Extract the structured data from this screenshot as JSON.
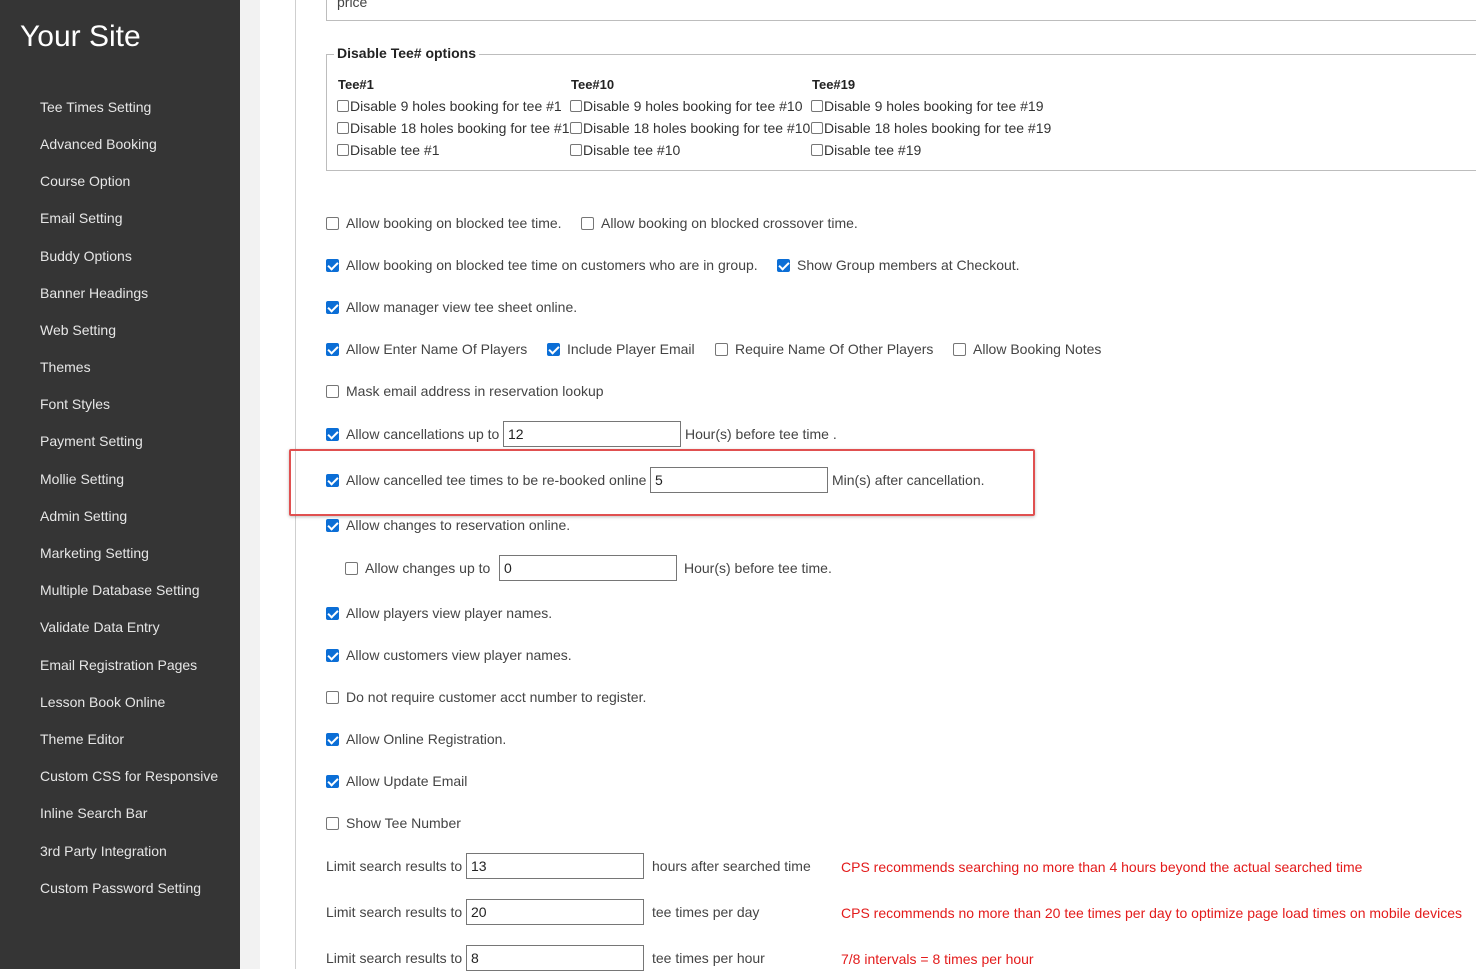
{
  "sidebar": {
    "title": "Your Site",
    "items": [
      {
        "label": "Tee Times Setting"
      },
      {
        "label": "Advanced Booking"
      },
      {
        "label": "Course Option"
      },
      {
        "label": "Email Setting"
      },
      {
        "label": "Buddy Options"
      },
      {
        "label": "Banner Headings"
      },
      {
        "label": "Web Setting"
      },
      {
        "label": "Themes"
      },
      {
        "label": "Font Styles"
      },
      {
        "label": "Payment Setting"
      },
      {
        "label": "Mollie Setting"
      },
      {
        "label": "Admin Setting"
      },
      {
        "label": "Marketing Setting"
      },
      {
        "label": "Multiple Database Setting"
      },
      {
        "label": "Validate Data Entry"
      },
      {
        "label": "Email Registration Pages"
      },
      {
        "label": "Lesson Book Online"
      },
      {
        "label": "Theme Editor"
      },
      {
        "label": "Custom CSS for Responsive"
      },
      {
        "label": "Inline Search Bar"
      },
      {
        "label": "3rd Party Integration"
      },
      {
        "label": "Custom Password Setting"
      }
    ]
  },
  "price": {
    "label": "price"
  },
  "disable_tee": {
    "legend": "Disable Tee# options",
    "columns": [
      {
        "head": "Tee#1",
        "opts": [
          "Disable 9 holes booking for tee #1",
          "Disable 18 holes booking for tee #1",
          "Disable tee #1"
        ]
      },
      {
        "head": "Tee#10",
        "opts": [
          "Disable 9 holes booking for tee #10",
          "Disable 18 holes booking for tee #10",
          "Disable tee #10"
        ]
      },
      {
        "head": "Tee#19",
        "opts": [
          "Disable 9 holes booking for tee #19",
          "Disable 18 holes booking for tee #19",
          "Disable tee #19"
        ]
      }
    ]
  },
  "options": {
    "blocked_tee": {
      "label": "Allow booking on blocked tee time.",
      "checked": false
    },
    "blocked_crossover": {
      "label": "Allow booking on blocked crossover time.",
      "checked": false
    },
    "blocked_group": {
      "label": "Allow booking on blocked tee time on customers who are in group.",
      "checked": true
    },
    "show_group": {
      "label": "Show Group members at Checkout.",
      "checked": true
    },
    "manager_view": {
      "label": "Allow manager view tee sheet online.",
      "checked": true
    },
    "enter_names": {
      "label": "Allow Enter Name Of Players",
      "checked": true
    },
    "player_email": {
      "label": "Include Player Email",
      "checked": true
    },
    "require_names": {
      "label": "Require Name Of Other Players",
      "checked": false
    },
    "booking_notes": {
      "label": "Allow Booking Notes",
      "checked": false
    },
    "mask_email": {
      "label": "Mask email address in reservation lookup",
      "checked": false
    },
    "cancellations": {
      "label": "Allow cancellations up to",
      "value": "12",
      "suffix": "Hour(s) before tee time .",
      "checked": true
    },
    "rebook": {
      "label": "Allow cancelled tee times to be re-booked online",
      "value": "5",
      "suffix": "Min(s) after cancellation.",
      "checked": true
    },
    "changes": {
      "label": "Allow changes to reservation online.",
      "checked": true
    },
    "changes_up_to": {
      "label": "Allow changes up to",
      "value": "0",
      "suffix": "Hour(s) before tee time.",
      "checked": false
    },
    "view_names": {
      "label": "Allow players view player names.",
      "checked": true
    },
    "cust_view_names": {
      "label": "Allow customers view player names.",
      "checked": true
    },
    "no_acct": {
      "label": "Do not require customer acct number to register.",
      "checked": false
    },
    "online_reg": {
      "label": "Allow Online Registration.",
      "checked": true
    },
    "update_email": {
      "label": "Allow Update Email",
      "checked": true
    },
    "show_tee": {
      "label": "Show Tee Number",
      "checked": false
    }
  },
  "limits": [
    {
      "label": "Limit search results to",
      "value": "13",
      "suffix": "hours after searched time",
      "note": "CPS recommends searching no more than 4 hours beyond the actual searched time"
    },
    {
      "label": "Limit search results to",
      "value": "20",
      "suffix": "tee times per day",
      "note": "CPS recommends no more than 20 tee times per day to optimize page load times on mobile devices"
    },
    {
      "label": "Limit search results to",
      "value": "8",
      "suffix": "tee times per hour",
      "note": "7/8 intervals = 8 times per hour"
    }
  ],
  "colors": {
    "sidebar_bg": "#353535",
    "checkbox_on": "#0b6ed6",
    "highlight": "#e05050",
    "note_red": "#e31b1b"
  }
}
